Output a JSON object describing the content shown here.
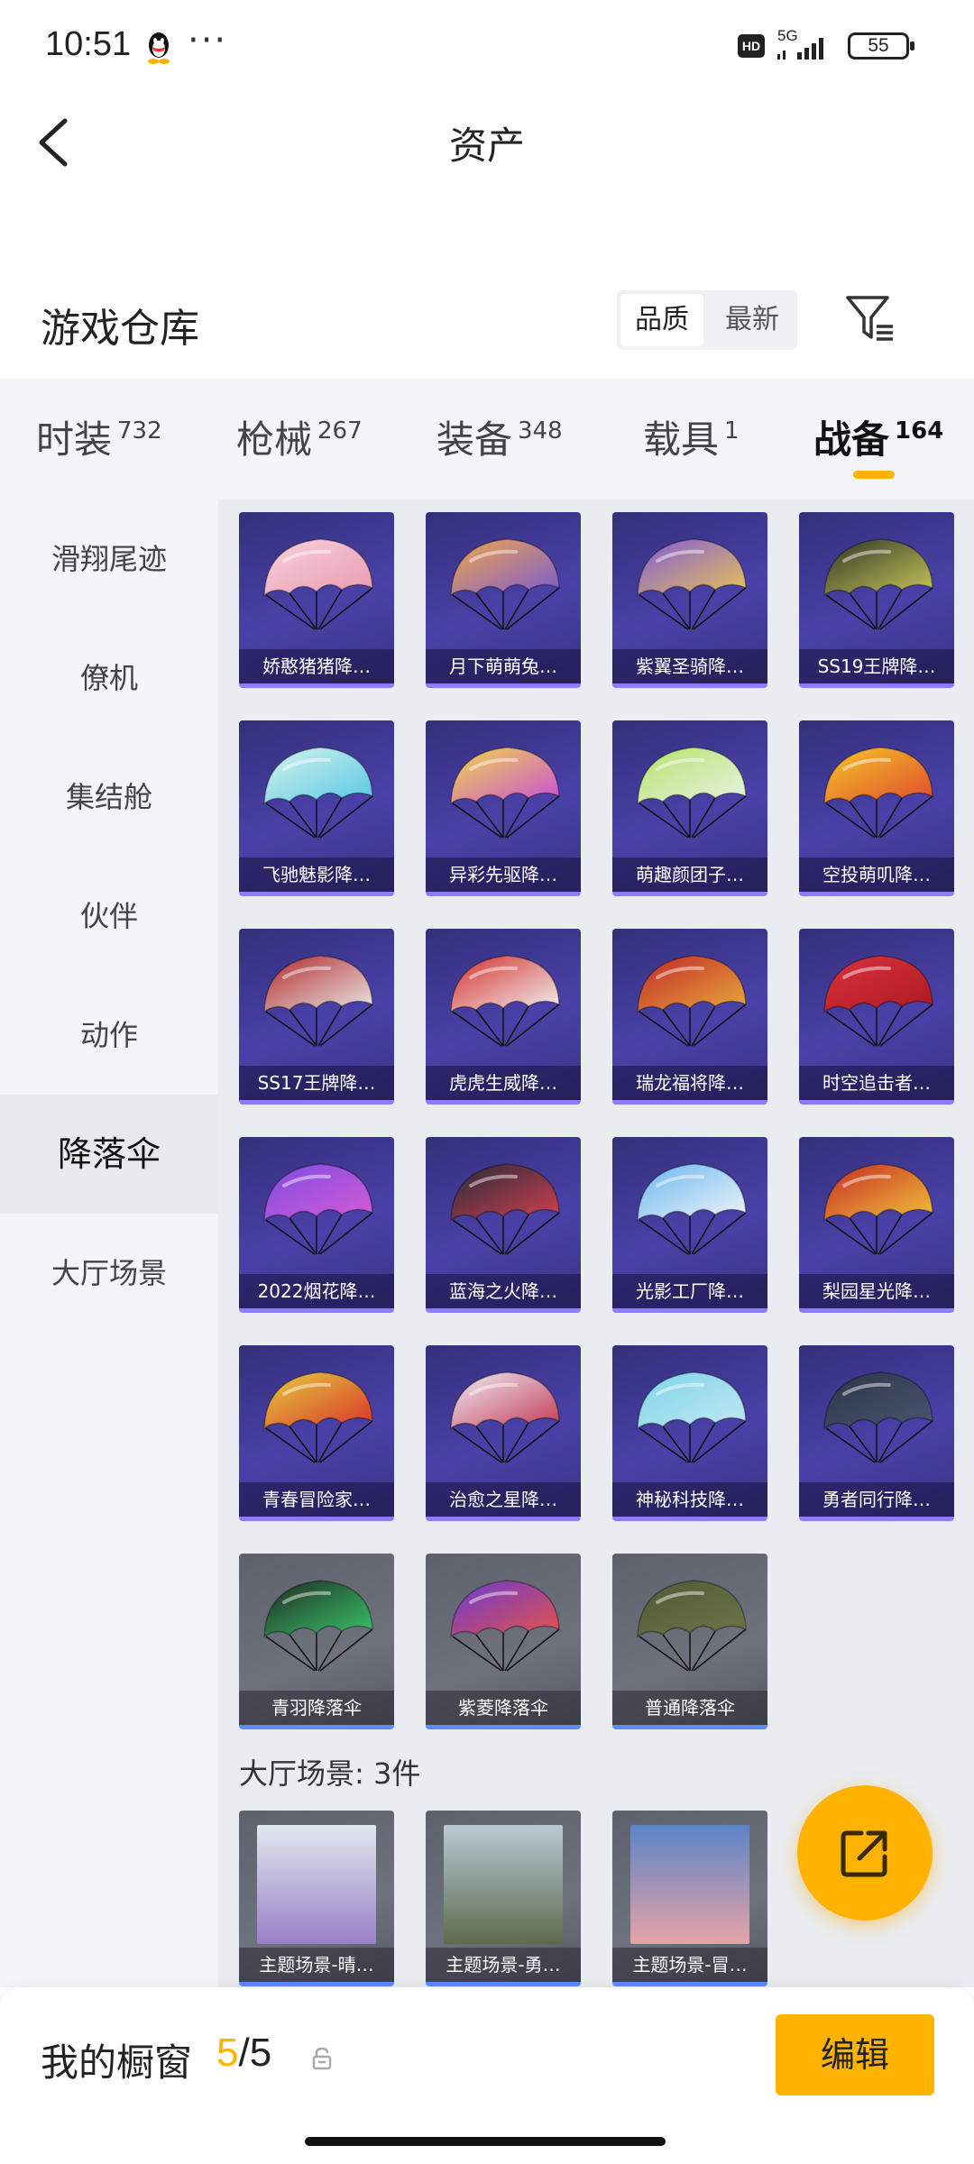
{
  "status_bar": {
    "time": "10:51",
    "dots": "···",
    "hd": "HD",
    "network": "5G",
    "battery": "55"
  },
  "header": {
    "title": "资产"
  },
  "warehouse": {
    "title": "游戏仓库",
    "sort_options": [
      "品质",
      "最新"
    ]
  },
  "tabs": [
    {
      "name": "时装",
      "count": "732"
    },
    {
      "name": "枪械",
      "count": "267"
    },
    {
      "name": "装备",
      "count": "348"
    },
    {
      "name": "载具",
      "count": "1"
    },
    {
      "name": "战备",
      "count": "164"
    }
  ],
  "sidebar": {
    "items": [
      "滑翔尾迹",
      "僚机",
      "集结舱",
      "伙伴",
      "动作",
      "降落伞",
      "大厅场景"
    ]
  },
  "parachutes": [
    {
      "label": "娇憨猪猪降…",
      "style": "purple",
      "colors": [
        "#f7d2dc",
        "#e99ab0"
      ]
    },
    {
      "label": "月下萌萌兔…",
      "style": "purple",
      "colors": [
        "#f2a64a",
        "#7a5bd1"
      ]
    },
    {
      "label": "紫翼圣骑降…",
      "style": "purple",
      "colors": [
        "#7e5bd6",
        "#e9c258"
      ]
    },
    {
      "label": "SS19王牌降…",
      "style": "purple",
      "colors": [
        "#2d3325",
        "#c8c85a"
      ]
    },
    {
      "label": "飞驰魅影降…",
      "style": "purple",
      "colors": [
        "#d7f3ea",
        "#57c7e6"
      ]
    },
    {
      "label": "异彩先驱降…",
      "style": "purple",
      "colors": [
        "#f0d84b",
        "#c94fd6"
      ]
    },
    {
      "label": "萌趣颜团子…",
      "style": "purple",
      "colors": [
        "#b5e26b",
        "#e9f2e3"
      ]
    },
    {
      "label": "空投萌叽降…",
      "style": "purple",
      "colors": [
        "#f6c72a",
        "#e04a2b"
      ]
    },
    {
      "label": "SS17王牌降…",
      "style": "purple",
      "colors": [
        "#b22a2a",
        "#e8e8e8"
      ]
    },
    {
      "label": "虎虎生威降…",
      "style": "purple",
      "colors": [
        "#d4302c",
        "#f1f1f1"
      ]
    },
    {
      "label": "瑞龙福将降…",
      "style": "purple",
      "colors": [
        "#c1282a",
        "#e7a93a"
      ]
    },
    {
      "label": "时空追击者…",
      "style": "purple",
      "colors": [
        "#d8323c",
        "#ad1a22"
      ]
    },
    {
      "label": "2022烟花降…",
      "style": "purple",
      "colors": [
        "#7c4ce0",
        "#d65bd8"
      ]
    },
    {
      "label": "蓝海之火降…",
      "style": "purple",
      "colors": [
        "#262a3a",
        "#d0404e"
      ]
    },
    {
      "label": "光影工厂降…",
      "style": "purple",
      "colors": [
        "#6ab6f0",
        "#f0f4f7"
      ]
    },
    {
      "label": "梨园星光降…",
      "style": "purple",
      "colors": [
        "#c42a24",
        "#f2c13a"
      ]
    },
    {
      "label": "青春冒险家…",
      "style": "purple",
      "colors": [
        "#e5ce3e",
        "#d9332a"
      ]
    },
    {
      "label": "治愈之星降…",
      "style": "purple",
      "colors": [
        "#efeef4",
        "#c33b57"
      ]
    },
    {
      "label": "神秘科技降…",
      "style": "purple",
      "colors": [
        "#7fd4ea",
        "#bfe8f3"
      ]
    },
    {
      "label": "勇者同行降…",
      "style": "purple",
      "colors": [
        "#2c3548",
        "#4a5570"
      ]
    },
    {
      "label": "青羽降落伞",
      "style": "grey",
      "colors": [
        "#1f2a22",
        "#39c56a"
      ]
    },
    {
      "label": "紫菱降落伞",
      "style": "grey",
      "colors": [
        "#6a3ad0",
        "#e4534a"
      ]
    },
    {
      "label": "普通降落伞",
      "style": "grey",
      "colors": [
        "#4f5a38",
        "#6b7648"
      ]
    }
  ],
  "lobby_section": {
    "label": "大厅场景: 3件"
  },
  "scenes": [
    {
      "label": "主题场景-晴…",
      "colors": [
        "#dfe9ef",
        "#9a7fc9"
      ]
    },
    {
      "label": "主题场景-勇…",
      "colors": [
        "#b8c9d6",
        "#5e6b4a"
      ]
    },
    {
      "label": "主题场景-冒…",
      "colors": [
        "#5b84c9",
        "#e6a3a6"
      ]
    }
  ],
  "bottom_bar": {
    "label": "我的橱窗",
    "count_current": "5",
    "count_total": "/5",
    "edit_label": "编辑"
  },
  "accent_color": "#ffb300"
}
